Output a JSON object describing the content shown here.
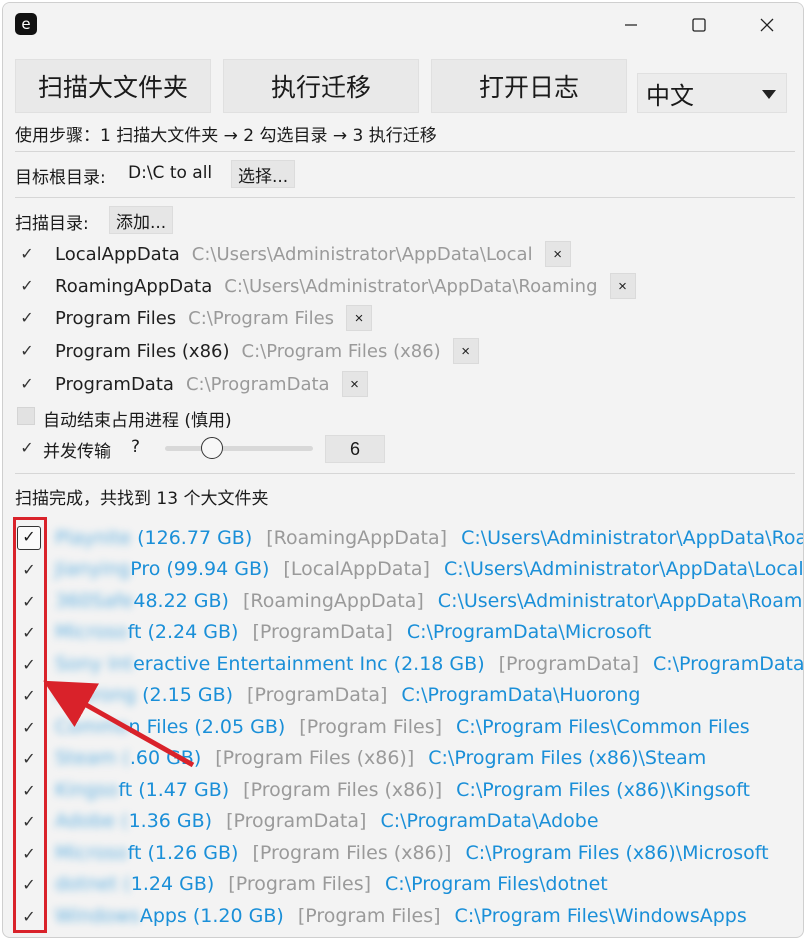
{
  "window": {
    "app_icon_letter": "e",
    "controls": {
      "minimize": "minimize",
      "maximize": "maximize",
      "close": "close"
    }
  },
  "toolbar": {
    "scan_label": "扫描大文件夹",
    "migrate_label": "执行迁移",
    "log_label": "打开日志",
    "language_value": "中文"
  },
  "steps_text": "使用步骤：1 扫描大文件夹 → 2 勾选目录 → 3 执行迁移",
  "target": {
    "label": "目标根目录:",
    "value": "D:\\C to all",
    "choose_label": "选择..."
  },
  "scan_dirs": {
    "label": "扫描目录:",
    "add_label": "添加...",
    "items": [
      {
        "checked": true,
        "name": "LocalAppData",
        "path": "C:\\Users\\Administrator\\AppData\\Local"
      },
      {
        "checked": true,
        "name": "RoamingAppData",
        "path": "C:\\Users\\Administrator\\AppData\\Roaming"
      },
      {
        "checked": true,
        "name": "Program Files",
        "path": "C:\\Program Files"
      },
      {
        "checked": true,
        "name": "Program Files (x86)",
        "path": "C:\\Program Files (x86)"
      },
      {
        "checked": true,
        "name": "ProgramData",
        "path": "C:\\ProgramData"
      }
    ],
    "remove_glyph": "×"
  },
  "options": {
    "auto_kill_label": "自动结束占用进程 (慎用)",
    "auto_kill_checked": false,
    "concurrent_label": "并发传输",
    "concurrent_help": "?",
    "concurrent_checked": true,
    "concurrent_value": "6",
    "concurrent_slider_fraction": 0.3
  },
  "status_text": "扫描完成，共找到 13 个大文件夹",
  "check_glyph": "✓",
  "results": [
    {
      "blurred": "Playnite",
      "name": " (126.77 GB)",
      "category": "[RoamingAppData]",
      "path": "C:\\Users\\Administrator\\AppData\\Roaming"
    },
    {
      "blurred": "Jianying",
      "name": "Pro (99.94 GB)",
      "category": "[LocalAppData]",
      "path": "C:\\Users\\Administrator\\AppData\\Local\\Jian"
    },
    {
      "blurred": "360Safe",
      "name": "48.22 GB)",
      "category": "[RoamingAppData]",
      "path": "C:\\Users\\Administrator\\AppData\\Roaming\\"
    },
    {
      "blurred": "Microso",
      "name": "ft (2.24 GB)",
      "category": "[ProgramData]",
      "path": "C:\\ProgramData\\Microsoft"
    },
    {
      "blurred": "Sony Int",
      "name": "eractive Entertainment Inc (2.18 GB)",
      "category": "[ProgramData]",
      "path": "C:\\ProgramData\\Sony"
    },
    {
      "blurred": "Huorong",
      "name": " (2.15 GB)",
      "category": "[ProgramData]",
      "path": "C:\\ProgramData\\Huorong"
    },
    {
      "blurred": "Commo",
      "name": "n Files (2.05 GB)",
      "category": "[Program Files]",
      "path": "C:\\Program Files\\Common Files"
    },
    {
      "blurred": "Steam (",
      "name": ".60 GB)",
      "category": "[Program Files (x86)]",
      "path": "C:\\Program Files (x86)\\Steam"
    },
    {
      "blurred": "Kingso",
      "name": "ft (1.47 GB)",
      "category": "[Program Files (x86)]",
      "path": "C:\\Program Files (x86)\\Kingsoft"
    },
    {
      "blurred": "Adobe (",
      "name": "1.36 GB)",
      "category": "[ProgramData]",
      "path": "C:\\ProgramData\\Adobe"
    },
    {
      "blurred": "Microso",
      "name": "ft (1.26 GB)",
      "category": "[Program Files (x86)]",
      "path": "C:\\Program Files (x86)\\Microsoft"
    },
    {
      "blurred": "dotnet (",
      "name": "1.24 GB)",
      "category": "[Program Files]",
      "path": "C:\\Program Files\\dotnet"
    },
    {
      "blurred": "Windows",
      "name": "Apps (1.20 GB)",
      "category": "[Program Files]",
      "path": "C:\\Program Files\\WindowsApps"
    }
  ],
  "colors": {
    "accent": "#1a8fd8",
    "highlight": "#d9222a",
    "muted": "#9a9a9a"
  }
}
